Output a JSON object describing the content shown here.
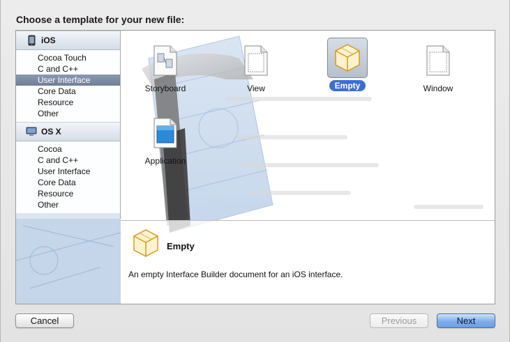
{
  "dialog": {
    "heading": "Choose a template for your new file:"
  },
  "sidebar": {
    "sections": [
      {
        "title": "iOS",
        "icon": "iphone-icon",
        "items": [
          "Cocoa Touch",
          "C and C++",
          "User Interface",
          "Core Data",
          "Resource",
          "Other"
        ]
      },
      {
        "title": "OS X",
        "icon": "mac-icon",
        "items": [
          "Cocoa",
          "C and C++",
          "User Interface",
          "Core Data",
          "Resource",
          "Other"
        ]
      }
    ],
    "selected": "User Interface"
  },
  "templates": [
    {
      "label": "Storyboard",
      "icon": "storyboard-icon"
    },
    {
      "label": "View",
      "icon": "view-icon"
    },
    {
      "label": "Empty",
      "icon": "empty-cube-icon",
      "selected": true
    },
    {
      "label": "Window",
      "icon": "window-icon"
    },
    {
      "label": "Application",
      "icon": "application-icon"
    }
  ],
  "detail": {
    "title": "Empty",
    "description": "An empty Interface Builder document for an iOS interface."
  },
  "buttons": {
    "cancel": "Cancel",
    "previous": "Previous",
    "next": "Next"
  },
  "colors": {
    "selection_blue": "#3d6fd1",
    "sidebar_selection": "#7a8aa4",
    "default_button": "#7eaee9"
  }
}
